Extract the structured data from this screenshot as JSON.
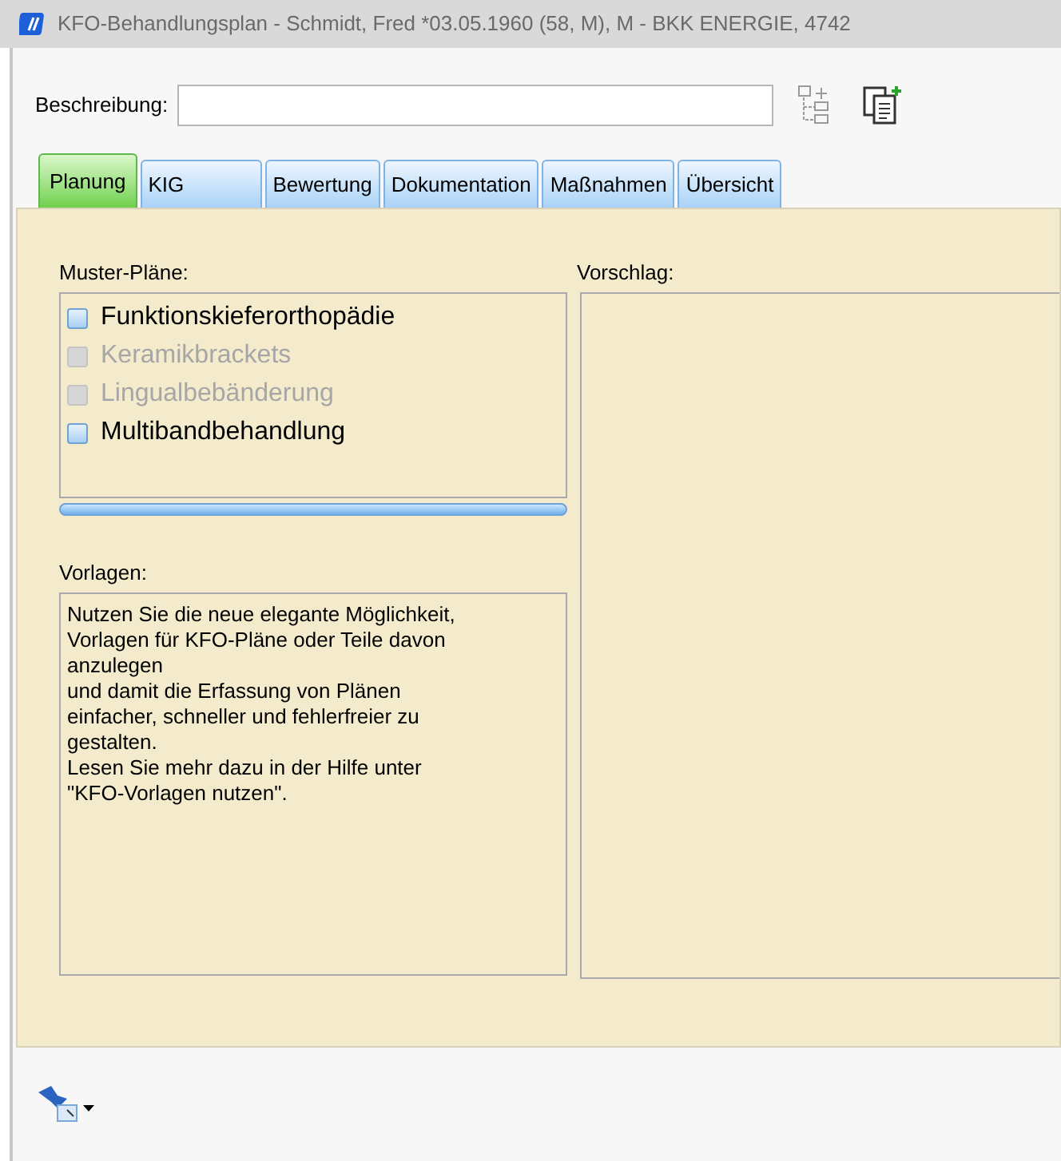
{
  "window": {
    "title": "KFO-Behandlungsplan - Schmidt, Fred  *03.05.1960 (58, M),  M - BKK ENERGIE,  4742"
  },
  "description": {
    "label": "Beschreibung:"
  },
  "tabs": [
    {
      "label": "Planung",
      "selected": true
    },
    {
      "label": "KIG",
      "selected": false
    },
    {
      "label": "Bewertung",
      "selected": false
    },
    {
      "label": "Dokumentation",
      "selected": false
    },
    {
      "label": "Maßnahmen",
      "selected": false
    },
    {
      "label": "Übersicht",
      "selected": false
    }
  ],
  "templates_list": {
    "label": "Muster-Pläne:",
    "items": [
      {
        "label": "Funktionskieferorthopädie",
        "checked": false,
        "disabled": false
      },
      {
        "label": "Keramikbrackets",
        "checked": false,
        "disabled": true
      },
      {
        "label": "Lingualbebänderung",
        "checked": false,
        "disabled": true
      },
      {
        "label": "Multibandbehandlung",
        "checked": false,
        "disabled": false
      }
    ]
  },
  "vorlagen": {
    "label": "Vorlagen:",
    "text": "Nutzen Sie die neue elegante Möglichkeit, Vorlagen für KFO-Pläne oder Teile davon anzulegen\nund damit die Erfassung von Plänen einfacher, schneller und fehlerfreier zu gestalten.\nLesen Sie mehr dazu in der Hilfe unter \"KFO-Vorlagen nutzen\"."
  },
  "suggestion": {
    "label": "Vorschlag:"
  }
}
